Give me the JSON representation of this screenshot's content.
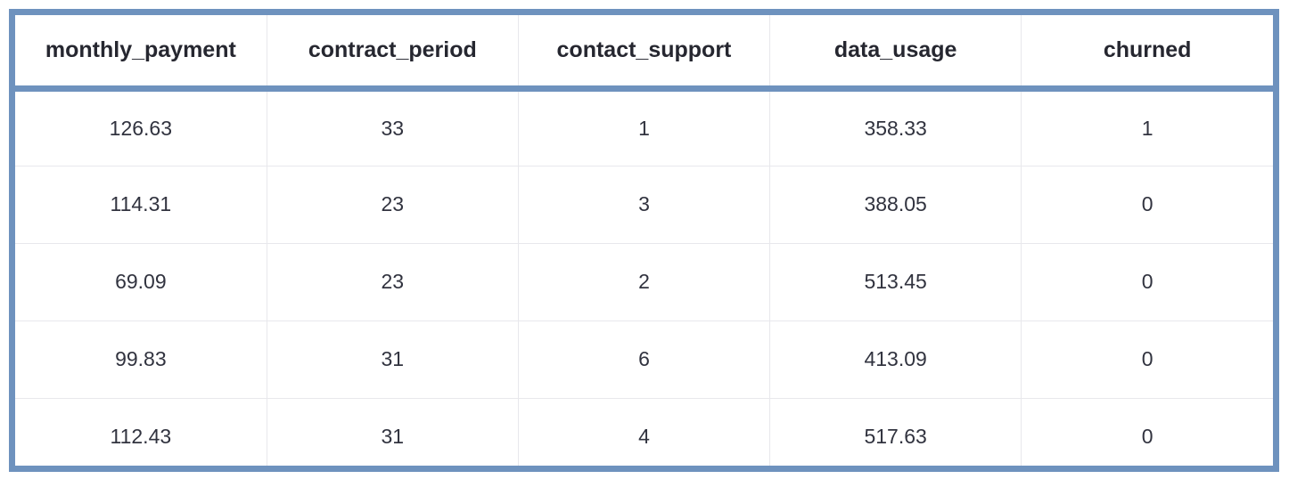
{
  "table": {
    "columns": [
      "monthly_payment",
      "contract_period",
      "contact_support",
      "data_usage",
      "churned"
    ],
    "rows": [
      [
        "126.63",
        "33",
        "1",
        "358.33",
        "1"
      ],
      [
        "114.31",
        "23",
        "3",
        "388.05",
        "0"
      ],
      [
        "69.09",
        "23",
        "2",
        "513.45",
        "0"
      ],
      [
        "99.83",
        "31",
        "6",
        "413.09",
        "0"
      ],
      [
        "112.43",
        "31",
        "4",
        "517.63",
        "0"
      ]
    ],
    "row_count": 5,
    "column_count": 5
  },
  "colors": {
    "border_accent": "#6E92BE",
    "header_text": "#262730",
    "cell_text": "#31333F",
    "grid_line": "#e8e8ec",
    "background": "#ffffff"
  },
  "chart_data": {
    "type": "table",
    "title": "",
    "columns": [
      "monthly_payment",
      "contract_period",
      "contact_support",
      "data_usage",
      "churned"
    ],
    "rows": [
      {
        "monthly_payment": 126.63,
        "contract_period": 33,
        "contact_support": 1,
        "data_usage": 358.33,
        "churned": 1
      },
      {
        "monthly_payment": 114.31,
        "contract_period": 23,
        "contact_support": 3,
        "data_usage": 388.05,
        "churned": 0
      },
      {
        "monthly_payment": 69.09,
        "contract_period": 23,
        "contact_support": 2,
        "data_usage": 513.45,
        "churned": 0
      },
      {
        "monthly_payment": 99.83,
        "contract_period": 31,
        "contact_support": 6,
        "data_usage": 413.09,
        "churned": 0
      },
      {
        "monthly_payment": 112.43,
        "contract_period": 31,
        "contact_support": 4,
        "data_usage": 517.63,
        "churned": 0
      }
    ]
  }
}
